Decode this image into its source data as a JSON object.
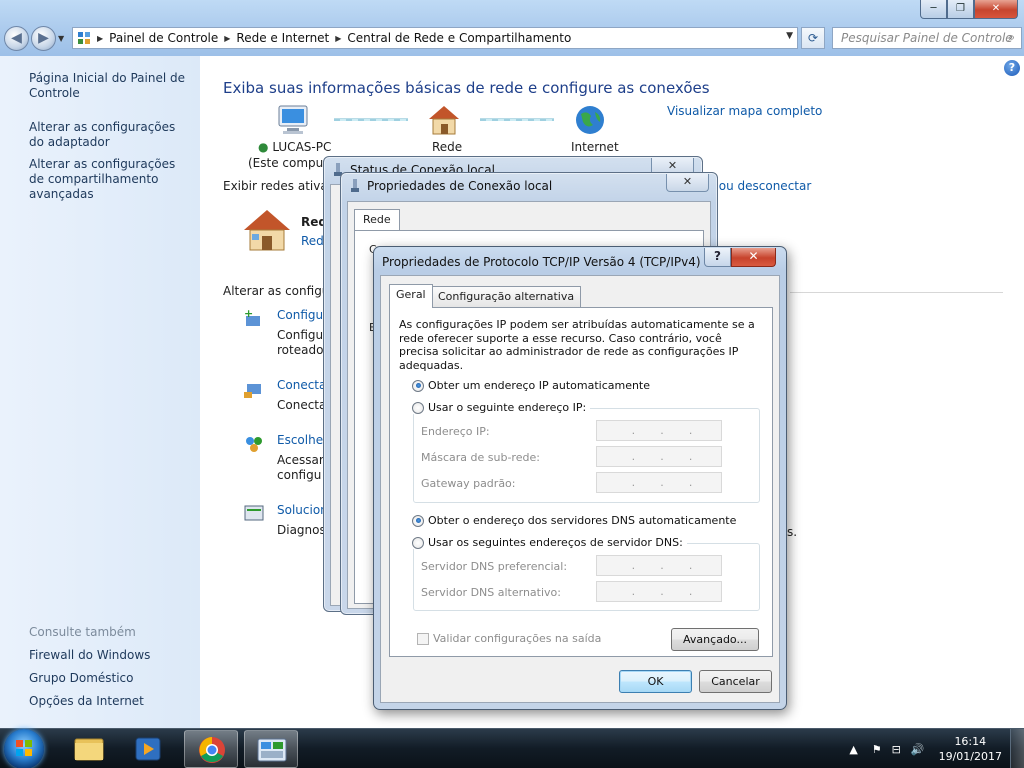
{
  "window": {
    "controls": {
      "minimize": "─",
      "maximize": "❐",
      "close": "✕"
    },
    "address": {
      "crumbs": [
        "Painel de Controle",
        "Rede e Internet",
        "Central de Rede e Compartilhamento"
      ]
    },
    "search_placeholder": "Pesquisar Painel de Controle"
  },
  "sidebar": {
    "links": [
      "Página Inicial do Painel de Controle",
      "Alterar as configurações do adaptador",
      "Alterar as configurações de compartilhamento avançadas"
    ],
    "see_also_heading": "Consulte também",
    "see_also": [
      "Firewall do Windows",
      "Grupo Doméstico",
      "Opções da Internet"
    ]
  },
  "main": {
    "heading": "Exiba suas informações básicas de rede e configure as conexões",
    "view_full_map": "Visualizar mapa completo",
    "nodes": {
      "computer": "LUCAS-PC",
      "computer_sub": "(Este computa",
      "network": "Rede",
      "internet": "Internet"
    },
    "active_networks": "Exibir redes ativas",
    "connect_disconnect": "r ou desconectar",
    "network_name": "Red",
    "network_type": "Rede",
    "change_settings": "Alterar as configura",
    "tasks": [
      {
        "title": "Configu",
        "line1": "Configu",
        "line2": "roteador"
      },
      {
        "title": "Conectar",
        "line1": "Conectar",
        "line2": ""
      },
      {
        "title": "Escolher",
        "line1": "Acessar a",
        "line2": "configu"
      },
      {
        "title": "Solucion",
        "line1": "Diagnost",
        "line2": ""
      }
    ],
    "task_trailing": "s."
  },
  "status_dialog": {
    "title": "Status de Conexão local"
  },
  "props_dialog": {
    "title": "Propriedades de Conexão local",
    "tab": "Rede",
    "partial1": "C",
    "partial2": "E"
  },
  "tcpip_dialog": {
    "title": "Propriedades de Protocolo TCP/IP Versão 4 (TCP/IPv4)",
    "help_btn": "?",
    "close_btn": "✕",
    "tabs": [
      "Geral",
      "Configuração alternativa"
    ],
    "description": "As configurações IP podem ser atribuídas automaticamente se a rede oferecer suporte a esse recurso. Caso contrário, você precisa solicitar ao administrador de rede as configurações IP adequadas.",
    "ip_auto": "Obter um endereço IP automaticamente",
    "ip_manual": "Usar o seguinte endereço IP:",
    "ip_fields": [
      "Endereço IP:",
      "Máscara de sub-rede:",
      "Gateway padrão:"
    ],
    "dns_auto": "Obter o endereço dos servidores DNS automaticamente",
    "dns_manual": "Usar os seguintes endereços de servidor DNS:",
    "dns_fields": [
      "Servidor DNS preferencial:",
      "Servidor DNS alternativo:"
    ],
    "ip_placeholder_dots": [
      ".",
      ".",
      "."
    ],
    "validate": "Validar configurações na saída",
    "advanced": "Avançado...",
    "ok": "OK",
    "cancel": "Cancelar",
    "selected_ip_option": "auto",
    "selected_dns_option": "auto"
  },
  "taskbar": {
    "time": "16:14",
    "date": "19/01/2017",
    "tray_icons": [
      "show-hidden-icon",
      "flag-icon",
      "network-icon",
      "volume-icon"
    ]
  }
}
